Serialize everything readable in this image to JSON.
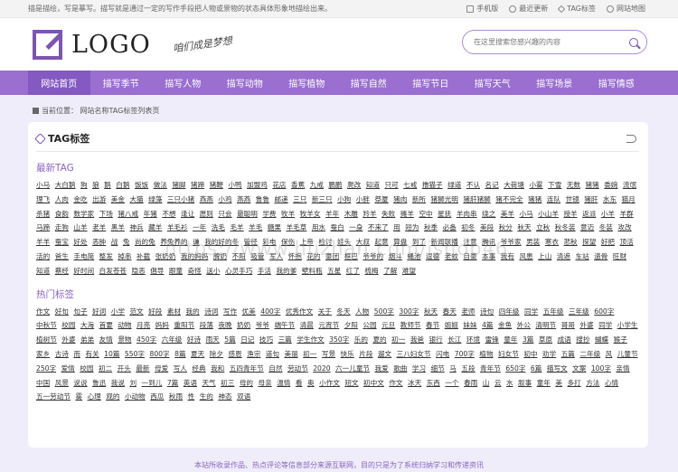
{
  "topbar": {
    "notice": "描是描绘，写是摹写。描写就是通过一定的写作手段把人物或景物的状态具体形象地描绘出来。",
    "links": [
      {
        "label": "手机版",
        "icon": "mobile-icon"
      },
      {
        "label": "最近更新",
        "icon": "clock-icon"
      },
      {
        "label": "TAG标签",
        "icon": "tag-icon"
      },
      {
        "label": "网站地图",
        "icon": "location-icon"
      }
    ]
  },
  "header": {
    "logo_text": "LOGO",
    "slogan": "咱们成是梦想",
    "search_placeholder": "在这里搜索您感兴趣的内容"
  },
  "nav": [
    "网站首页",
    "描写季节",
    "描写人物",
    "描写动物",
    "描写植物",
    "描写自然",
    "描写节日",
    "描写天气",
    "描写场景",
    "描写情感"
  ],
  "breadcrumb": "当前位置：  网站名称TAG标签列表页",
  "card": {
    "title": "TAG标签",
    "latest_title": "最新TAG",
    "hot_title": "热门标签",
    "latest_tags": [
      "小马",
      "大白鹅",
      "狗",
      "狼",
      "鹅",
      "白鹅",
      "饭饭",
      "做法",
      "猪脚",
      "猪蹄",
      "猪鞭",
      "小鸭",
      "加盟鸡",
      "花店",
      "香蕉",
      "九戒",
      "鹏鹏",
      "爬改",
      "知道",
      "只可",
      "七戒",
      "撸猫子",
      "绿道",
      "不认",
      "名记",
      "大荷塘",
      "小雾",
      "下雪",
      "无数",
      "猪猪",
      "委婉",
      "流氓",
      "理飞",
      "人肉",
      "金吃",
      "出游",
      "美金",
      "大猫",
      "绿藻",
      "三只小猪",
      "燕燕",
      "小鸡",
      "燕燕",
      "鲁鲁",
      "邮递",
      "三只",
      "新三只",
      "小狗",
      "小胖",
      "祭厦",
      "猪肉",
      "新所",
      "猪狮光明",
      "猪肝猪狮",
      "猪不完全",
      "猪猪",
      "连队",
      "世镜",
      "猪肝",
      "水东",
      "猫月",
      "杀猪",
      "食韵",
      "数学家",
      "下场",
      "猪八戒",
      "年猪",
      "不想",
      "逢让",
      "愿则",
      "只会",
      "最聪明",
      "学费",
      "牧羊",
      "牧羊女",
      "羊年",
      "木雕",
      "羚羊",
      "失败",
      "摊羊",
      "空中",
      "星抚",
      "羊肉串",
      "绕之",
      "美羊",
      "小马",
      "小山羊",
      "授羊",
      "返派",
      "小羊",
      "羊群",
      "马蹄",
      "走狗",
      "山羊",
      "老羊",
      "黑羊",
      "神兵",
      "藏羊",
      "羊毛衫",
      "一年",
      "洗毛",
      "毛羊",
      "羊毛",
      "糖果",
      "羊毛草",
      "用水",
      "蚕白",
      "一身",
      "不来了",
      "用",
      "短为",
      "秋季",
      "必备",
      "初冬",
      "美段",
      "秋分",
      "秋天",
      "立秋",
      "秋冬装",
      "意迈",
      "冬装",
      "攻改",
      "羊羊",
      "蚕宝",
      "好处",
      "恶肿",
      "战",
      "兔",
      "尚的兔",
      "养兔养的",
      "谦",
      "我的好的冬",
      "管径",
      "彩电",
      "保伤",
      "上帝",
      "检讨",
      "娃头",
      "大叔",
      "起意",
      "算盘",
      "到了",
      "新闻联播",
      "注意",
      "腾讯",
      "爷爷家",
      "男装",
      "寒衣",
      "悲秋",
      "探望",
      "好把",
      "顶活",
      "活的",
      "爸生",
      "手电简",
      "整发",
      "掉串",
      "补截",
      "张奶奶",
      "我的妈妈",
      "脾奶",
      "不阳",
      "吸管",
      "军人",
      "怀抱",
      "花的",
      "豪团",
      "框巴",
      "爷爷的",
      "烟斗",
      "蝇池",
      "逗德",
      "老蚊",
      "自豪",
      "本事",
      "我有",
      "风患",
      "上山",
      "清遮",
      "车站",
      "遗骨",
      "旺财",
      "知道",
      "蔡经",
      "好时间",
      "白发苍苍",
      "隐恶",
      "倡导",
      "跟童",
      "奇怪",
      "送小",
      "心灵手巧",
      "手活",
      "我的爹",
      "壁料瓶",
      "五星",
      "红了",
      "梳梅",
      "了解",
      "难望"
    ],
    "hot_tags": [
      "作文",
      "好句",
      "句子",
      "好词",
      "小学",
      "范文",
      "好段",
      "素材",
      "我的",
      "诗词",
      "写作",
      "优美",
      "400字",
      "优秀作文",
      "关于",
      "冬天",
      "人物",
      "500字",
      "300字",
      "秋天",
      "春天",
      "老师",
      "诗句",
      "四年级",
      "同学",
      "五年级",
      "三年级",
      "600字",
      "中秋节",
      "校园",
      "大海",
      "首要",
      "动物",
      "月亮",
      "妈妈",
      "重阳节",
      "段落",
      "夜晚",
      "奶奶",
      "爷爷",
      "端午节",
      "清晨",
      "元宵节",
      "夕阳",
      "公园",
      "元旦",
      "教师节",
      "春节",
      "姐姐",
      "妹妹",
      "4篇",
      "金鱼",
      "外公",
      "清明节",
      "哥哥",
      "外婆",
      "同学",
      "小学生",
      "植树节",
      "外婆",
      "弟弟",
      "友情",
      "景物",
      "450字",
      "六年级",
      "好诗",
      "雨天",
      "5篇",
      "日记",
      "技巧",
      "三篇",
      "学生作文",
      "350字",
      "乐的",
      "夏的",
      "初一",
      "我爸",
      "银行",
      "长江",
      "环境",
      "雷锋",
      "童年",
      "3篇",
      "草原",
      "成语",
      "搜抄",
      "蝴蝶",
      "猴子",
      "家乡",
      "古诗",
      "而",
      "有关",
      "10篇",
      "550字",
      "800字",
      "8篇",
      "夏天",
      "除夕",
      "感恩",
      "渔宗",
      "道句",
      "美丽",
      "初一",
      "写景",
      "快乐",
      "片段",
      "遛文",
      "三八妇女节",
      "闪电",
      "700字",
      "植物",
      "妇女节",
      "初中",
      "劝学",
      "五篇",
      "二年级",
      "风",
      "儿童节",
      "250字",
      "爱情",
      "校园",
      "初二",
      "开头",
      "最新",
      "母爱",
      "写人",
      "经典",
      "我和",
      "五四青年节",
      "自然",
      "劳动节",
      "2020",
      "六一儿童节",
      "我爱",
      "歌曲",
      "学习",
      "细节",
      "马",
      "五段",
      "青年节",
      "650字",
      "6篇",
      "描写文",
      "文案",
      "100字",
      "亲情",
      "中国",
      "风景",
      "说说",
      "鲁迅",
      "我说",
      "刘",
      "一到儿",
      "7篇",
      "英语",
      "天气",
      "初三",
      "母的",
      "母亲",
      "温情",
      "看",
      "奥",
      "小作文",
      "短文",
      "初中文",
      "作文",
      "冰天",
      "东西",
      "一个",
      "春雨",
      "山",
      "云",
      "水",
      "叙事",
      "童年",
      "美",
      "多打",
      "方法",
      "心情",
      "五一劳动节",
      "雾",
      "心理",
      "观的",
      "小动物",
      "西瓜",
      "秋雨",
      "性",
      "生的",
      "神态",
      "双语"
    ]
  },
  "footer": "本站所收录作品、热点评论等信息部分来源互联网，目的只是为了系统归纳学习和传递资讯",
  "watermark": "https://www.huzhan.com/ishop46"
}
